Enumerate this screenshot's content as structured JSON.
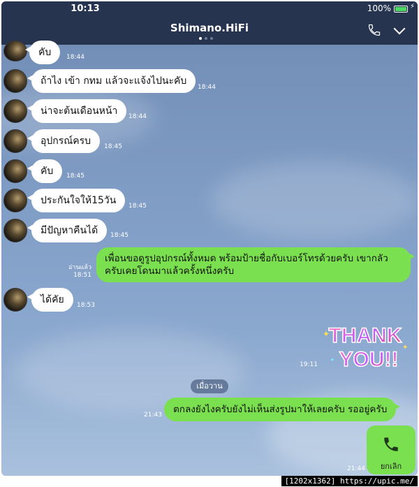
{
  "status_bar": {
    "time": "10:13",
    "battery": "100%"
  },
  "header": {
    "title": "Shimano.HiFi"
  },
  "messages": [
    {
      "text": "คับ",
      "time": "18:44"
    },
    {
      "text": "ถ้าไง เข้า กทม แล้วจะแจ้งไปนะคับ",
      "time": "18:44"
    },
    {
      "text": "น่าจะต้นเดือนหน้า",
      "time": "18:44"
    },
    {
      "text": "อุปกรณ์ครบ",
      "time": "18:45"
    },
    {
      "text": "คับ",
      "time": "18:45"
    },
    {
      "text": "ประกันใจให้15วัน",
      "time": "18:45"
    },
    {
      "text": "มีปัญหาคืนได้",
      "time": "18:45"
    },
    {
      "text_line1": "เพื่อนขอดูรูปอุปกรณ์ทั้งหมด พร้อมป้ายชื่อกับเบอร์โทรด้วยครับ เขากลัว",
      "text_line2": "ครับเคยโดนมาแล้วครั้งหนึ่งครับ",
      "read": "อ่านแล้ว",
      "time": "18:51"
    },
    {
      "text": "ได้คัย",
      "time": "18:53"
    },
    {
      "sticker_line1": "THANK",
      "sticker_line2": "YOU!!",
      "time": "19:11"
    },
    {
      "text": "ตกลงยังไงครับยังไม่เห็นส่งรูปมาให้เลยครับ รออยู่ครับ",
      "time": "21:43"
    },
    {
      "call_label": "ยกเลิก",
      "time": "21:44"
    }
  ],
  "date_separator": "เมื่อวาน",
  "footer": "[1202x1362] https://upic.me/",
  "colors": {
    "header": "#263450",
    "incoming": "#ffffff",
    "outgoing": "#7ae04f"
  }
}
